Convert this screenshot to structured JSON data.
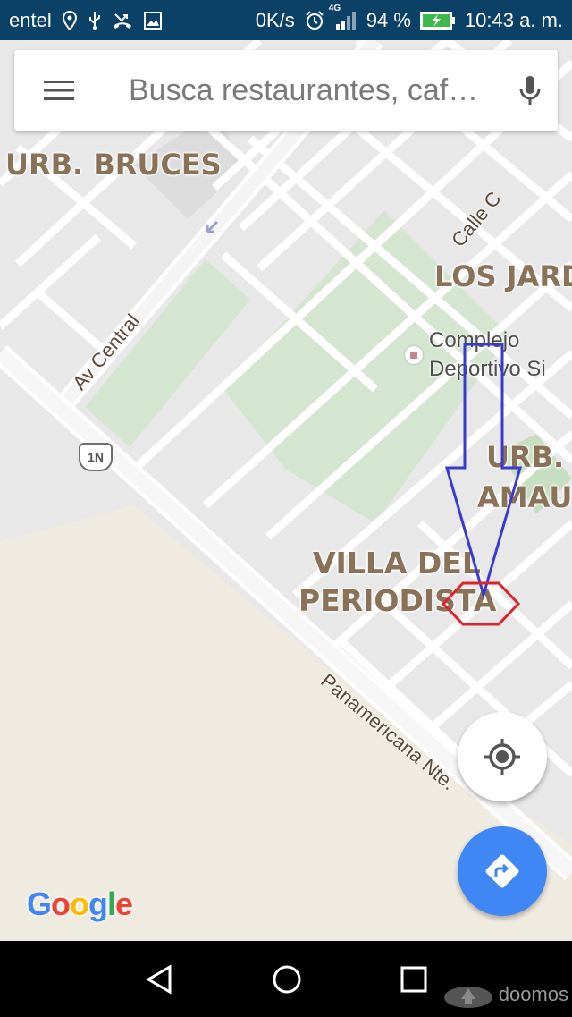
{
  "status_bar": {
    "carrier": "entel",
    "speed": "0K/s",
    "network": "4G",
    "battery": "94 %",
    "time": "10:43 a. m."
  },
  "search": {
    "placeholder": "Busca restaurantes, caf…"
  },
  "map": {
    "areas": [
      {
        "name": "URB. BRUCES"
      },
      {
        "name": "LOS JARD"
      },
      {
        "name": "URB. I"
      },
      {
        "name": "AMAU"
      },
      {
        "name": "VILLA DEL"
      },
      {
        "name": "PERIODISTA"
      }
    ],
    "streets": [
      {
        "name": "Av Central"
      },
      {
        "name": "Calle C"
      },
      {
        "name": "Panamericana Nte."
      }
    ],
    "poi": {
      "line1": "Complejo",
      "line2": "Deportivo Si"
    },
    "route_shield": "1N"
  },
  "attribution": {
    "logo": "Google"
  },
  "watermark": "doomos",
  "colors": {
    "status_bar": "#0b4167",
    "map_bg": "#e8e8e8",
    "road": "#ffffff",
    "park": "#d4e6cf",
    "sand": "#f0ebe1",
    "accent_blue": "#3f87f5",
    "annotation_arrow": "#3a3ad0",
    "annotation_hexagon": "#e0222e"
  }
}
